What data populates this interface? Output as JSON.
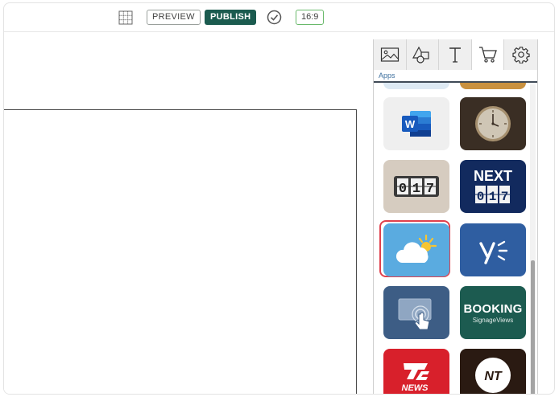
{
  "toolbar": {
    "grid_icon": "grid-icon",
    "preview_label": "PREVIEW",
    "publish_label": "PUBLISH",
    "check_icon": "check-circle-icon",
    "aspect_ratio": "16:9",
    "colors": {
      "publish_bg": "#1b5b4f",
      "ratio_border": "#69b96b"
    }
  },
  "panel": {
    "tabs": [
      {
        "icon": "image-icon",
        "active": false
      },
      {
        "icon": "shapes-icon",
        "active": false
      },
      {
        "icon": "text-icon",
        "active": false
      },
      {
        "icon": "cart-icon",
        "active": true
      },
      {
        "icon": "gear-icon",
        "active": false
      }
    ],
    "section_label": "Apps",
    "apps": [
      {
        "icon": "word-icon",
        "label": "",
        "bg": "#eeeeee"
      },
      {
        "icon": "clock-icon",
        "label": "",
        "bg": "#3a2e24"
      },
      {
        "icon": "counter-icon",
        "label": "",
        "digits": [
          "0",
          "1",
          "7"
        ],
        "bg": "#d6ccc0"
      },
      {
        "icon": "next-counter-icon",
        "label": "NEXT",
        "digits": [
          "0",
          "1",
          "7"
        ],
        "bg": "#122a5e"
      },
      {
        "icon": "weather-icon",
        "label": "",
        "bg": "#5aabe0",
        "selected": true
      },
      {
        "icon": "yammer-icon",
        "label": "",
        "bg": "#2f5ea1"
      },
      {
        "icon": "touch-screen-icon",
        "label": "",
        "bg": "#3d5d85"
      },
      {
        "icon": "booking-icon",
        "label": "BOOKING",
        "sublabel": "SignageViews",
        "bg": "#1c5b50"
      },
      {
        "icon": "tv2-news-icon",
        "label": "NEWS",
        "bg": "#d8202b"
      },
      {
        "icon": "nt-icon",
        "label": "NT",
        "bg": "#2a1a12"
      }
    ]
  }
}
